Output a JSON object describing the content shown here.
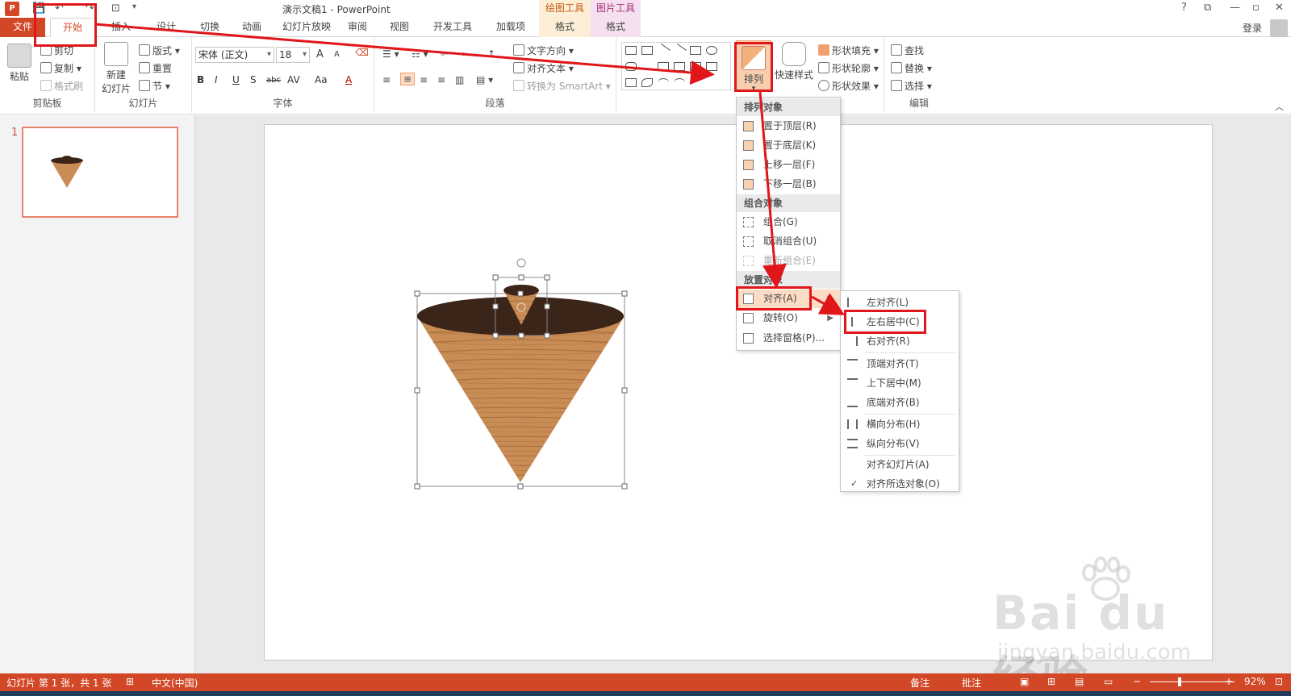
{
  "titlebar": {
    "doc_title": "演示文稿1 - PowerPoint",
    "app_logo": "P",
    "context_draw": "绘图工具",
    "context_pic": "图片工具",
    "help": "?",
    "restore": "⧉",
    "minimize": "—",
    "maximize": "▫",
    "close": "✕"
  },
  "tabs": [
    "文件",
    "开始",
    "插入",
    "设计",
    "切换",
    "动画",
    "幻灯片放映",
    "审阅",
    "视图",
    "开发工具",
    "加载项",
    "格式",
    "格式"
  ],
  "account": {
    "login": "登录"
  },
  "ribbon": {
    "clipboard": {
      "label": "剪贴板",
      "paste": "粘贴",
      "cut": "剪切",
      "copy": "复制",
      "format_painter": "格式刷"
    },
    "slides": {
      "label": "幻灯片",
      "new_slide_1": "新建",
      "new_slide_2": "幻灯片",
      "layout": "版式",
      "reset": "重置",
      "section": "节"
    },
    "font": {
      "label": "字体",
      "font_name": "宋体 (正文)",
      "font_size": "18",
      "bold": "B",
      "italic": "I",
      "underline": "U",
      "shadow": "S",
      "strike": "abc",
      "spacing": "AV",
      "case": "Aa",
      "color": "A",
      "grow": "A",
      "shrink": "A"
    },
    "paragraph": {
      "label": "段落",
      "text_direction": "文字方向",
      "align_text": "对齐文本",
      "smartart": "转换为 SmartArt"
    },
    "drawing": {
      "arrange": "排列",
      "quick_styles": "快速样式",
      "fill": "形状填充",
      "outline": "形状轮廓",
      "effects": "形状效果"
    },
    "editing": {
      "label": "编辑",
      "find": "查找",
      "replace": "替换",
      "select": "选择"
    }
  },
  "thumbnail": {
    "number": "1"
  },
  "arrange_menu": {
    "header_order": "排列对象",
    "bring_front": "置于顶层(R)",
    "send_back": "置于底层(K)",
    "bring_forward": "上移一层(F)",
    "send_backward": "下移一层(B)",
    "header_group": "组合对象",
    "group": "组合(G)",
    "ungroup": "取消组合(U)",
    "regroup": "重新组合(E)",
    "header_position": "放置对象",
    "align": "对齐(A)",
    "rotate": "旋转(O)",
    "selection_pane": "选择窗格(P)..."
  },
  "align_submenu": {
    "left": "左对齐(L)",
    "center": "左右居中(C)",
    "right": "右对齐(R)",
    "top": "顶端对齐(T)",
    "middle": "上下居中(M)",
    "bottom": "底端对齐(B)",
    "dist_h": "横向分布(H)",
    "dist_v": "纵向分布(V)",
    "align_slide": "对齐幻灯片(A)",
    "align_selected": "对齐所选对象(O)",
    "checked": "✓"
  },
  "statusbar": {
    "slide_info": "幻灯片 第 1 张，共 1 张",
    "language": "中文(中国)",
    "notes": "备注",
    "comments": "批注",
    "zoom": "92%",
    "minus": "−",
    "plus": "+"
  },
  "watermark": {
    "main": "Bai du 经验",
    "url": "jingyan.baidu.com"
  },
  "colors": {
    "accent": "#d24726",
    "highlight": "#e0161a",
    "wood_light": "#c98c55",
    "wood_dark": "#3b2418"
  }
}
